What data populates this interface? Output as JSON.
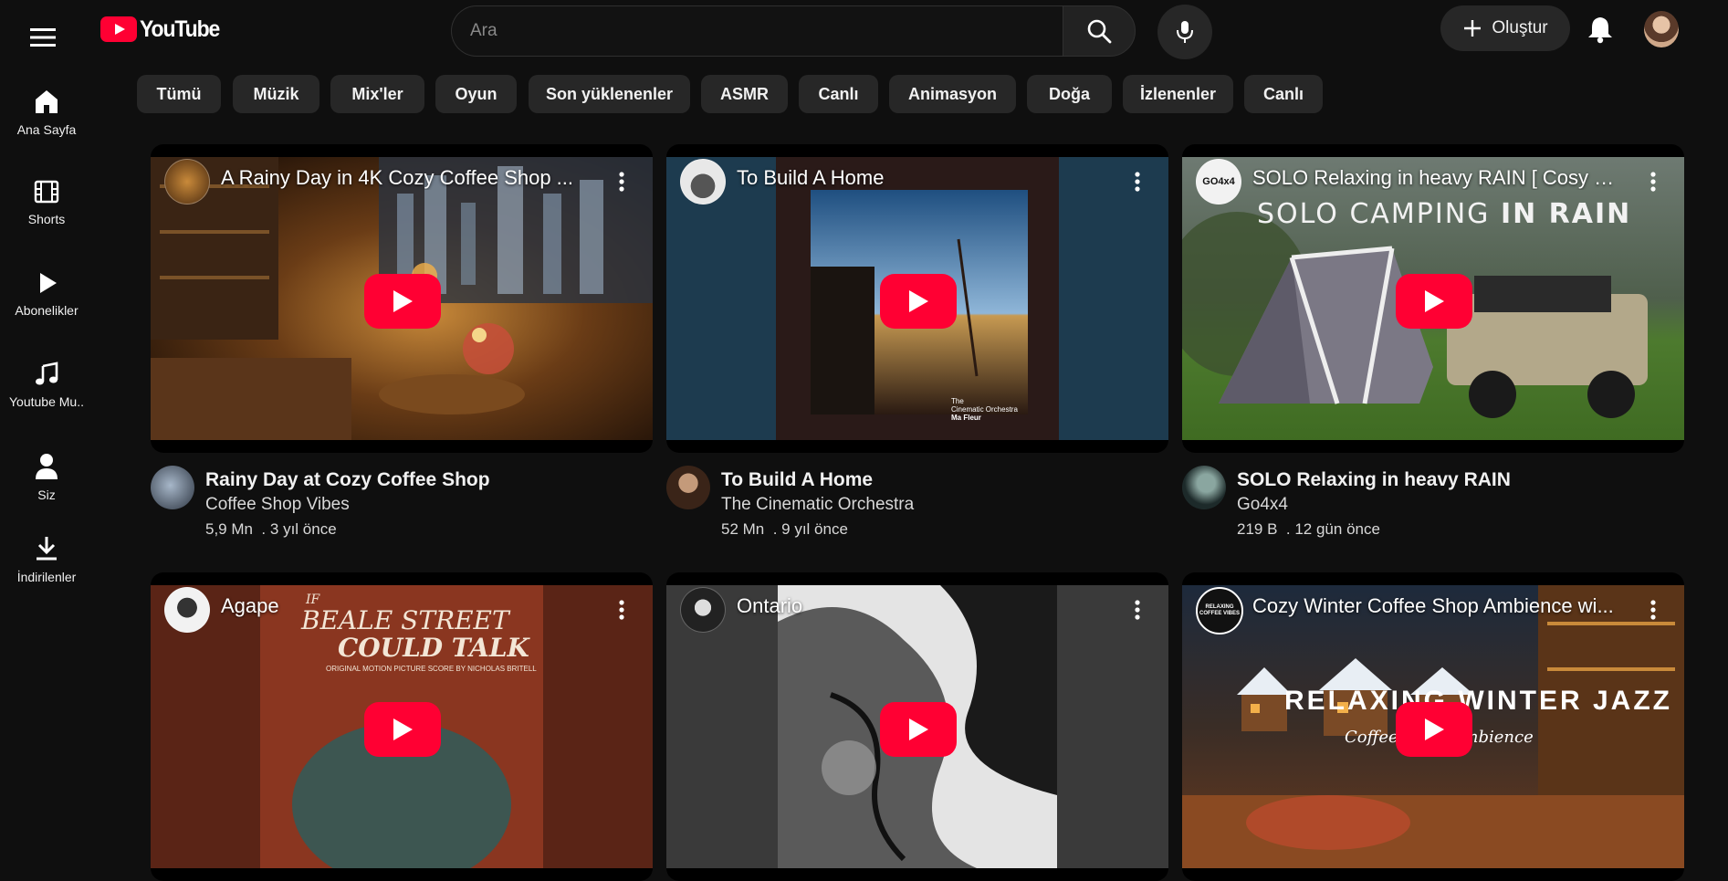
{
  "header": {
    "logo_text": "YouTube",
    "search_placeholder": "Ara",
    "create_label": "Oluştur"
  },
  "sidebar": {
    "items": [
      {
        "label": "Ana Sayfa",
        "icon": "home-icon"
      },
      {
        "label": "Shorts",
        "icon": "shorts-icon"
      },
      {
        "label": "Abonelikler",
        "icon": "play-icon"
      },
      {
        "label": "Youtube Mu..",
        "icon": "music-note-icon"
      },
      {
        "label": "Siz",
        "icon": "person-icon"
      },
      {
        "label": "İndirilenler",
        "icon": "download-icon"
      }
    ]
  },
  "chips": [
    "Tümü",
    "Müzik",
    "Mix'ler",
    "Oyun",
    "Son yüklenenler",
    "ASMR",
    "Canlı",
    "Animasyon",
    "Doğa",
    "İzlenenler",
    "Canlı"
  ],
  "videos": [
    {
      "overlay_title": "A Rainy Day in 4K Cozy Coffee Shop ...",
      "title": "Rainy Day at Cozy Coffee Shop",
      "channel": "Coffee Shop Vibes",
      "views": "5,9 Mn",
      "age": "3 yıl önce"
    },
    {
      "overlay_title": "To Build A Home",
      "title": "To Build A Home",
      "channel": "The Cinematic Orchestra",
      "views": "52 Mn",
      "age": "9 yıl önce",
      "art_text_1": "The",
      "art_text_2": "Cinematic Orchestra",
      "art_text_3": "Ma Fleur"
    },
    {
      "overlay_title": "SOLO Relaxing in heavy RAIN [ Cosy C...",
      "title": "SOLO Relaxing in heavy RAIN",
      "channel": "Go4x4",
      "views": "219 B",
      "age": "12 gün önce",
      "art_text_1": "SOLO CAMPING ",
      "art_text_2": "IN RAIN",
      "badge": "GO4x4"
    },
    {
      "overlay_title": "Agape",
      "art_text_1": "IF",
      "art_text_2": "BEALE STREET",
      "art_text_3": "COULD TALK",
      "art_text_4": "ORIGINAL MOTION PICTURE SCORE BY NICHOLAS BRITELL"
    },
    {
      "overlay_title": "Ontario"
    },
    {
      "overlay_title": "Cozy Winter Coffee Shop Ambience wi...",
      "art_text_1": "RELAXING WINTER JAZZ",
      "art_text_2": "Coffee Shop Ambience",
      "badge": "RELAXING COFFEE VIBES"
    }
  ],
  "colors": {
    "background": "#0f0f0f",
    "chip": "#272727",
    "play_red": "#ff0033"
  }
}
